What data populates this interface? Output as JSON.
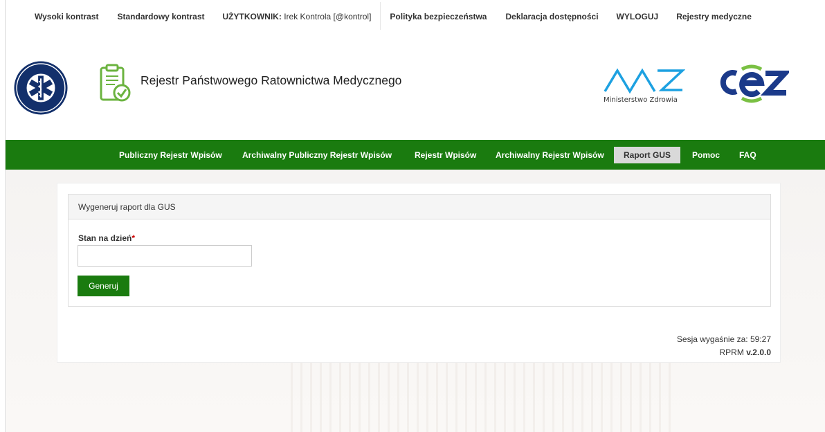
{
  "topbar": {
    "high_contrast": "Wysoki kontrast",
    "standard_contrast": "Standardowy kontrast",
    "user_label": "UŻYTKOWNIK:",
    "user_value": "Irek Kontrola [@kontrol]",
    "security_policy": "Polityka bezpieczeństwa",
    "accessibility": "Deklaracja dostępności",
    "logout": "WYLOGUJ",
    "medical_registries": "Rejestry medyczne"
  },
  "header": {
    "app_title": "Rejestr Państwowego Ratownictwa Medycznego",
    "prm_logo_icon": "medical-emergency-emblem-icon",
    "clipboard_icon": "clipboard-check-icon",
    "mz_label": "Ministerstwo Zdrowia",
    "cez_logo_icon": "cez-logo-icon"
  },
  "nav": {
    "items": [
      "Publiczny Rejestr Wpisów",
      "Archiwalny Publiczny Rejestr Wpisów",
      "Rejestr Wpisów",
      "Archiwalny Rejestr Wpisów",
      "Raport GUS",
      "Pomoc",
      "FAQ"
    ],
    "active": "Raport GUS"
  },
  "panel": {
    "title": "Wygeneruj raport dla GUS",
    "field_label": "Stan na dzień",
    "required_mark": "*",
    "input_value": "",
    "button_label": "Generuj"
  },
  "footer": {
    "session_label": "Sesja wygaśnie za:",
    "session_time": "59:27",
    "app_short": "RPRM",
    "version": "v.2.0.0"
  },
  "colors": {
    "primary_green": "#1a7b0f",
    "active_tab_bg": "#d9d9d9",
    "required": "#cc0000",
    "mz_blue": "#1da1e1",
    "cez_blue": "#1b3a8a",
    "cez_green": "#7ac043"
  }
}
